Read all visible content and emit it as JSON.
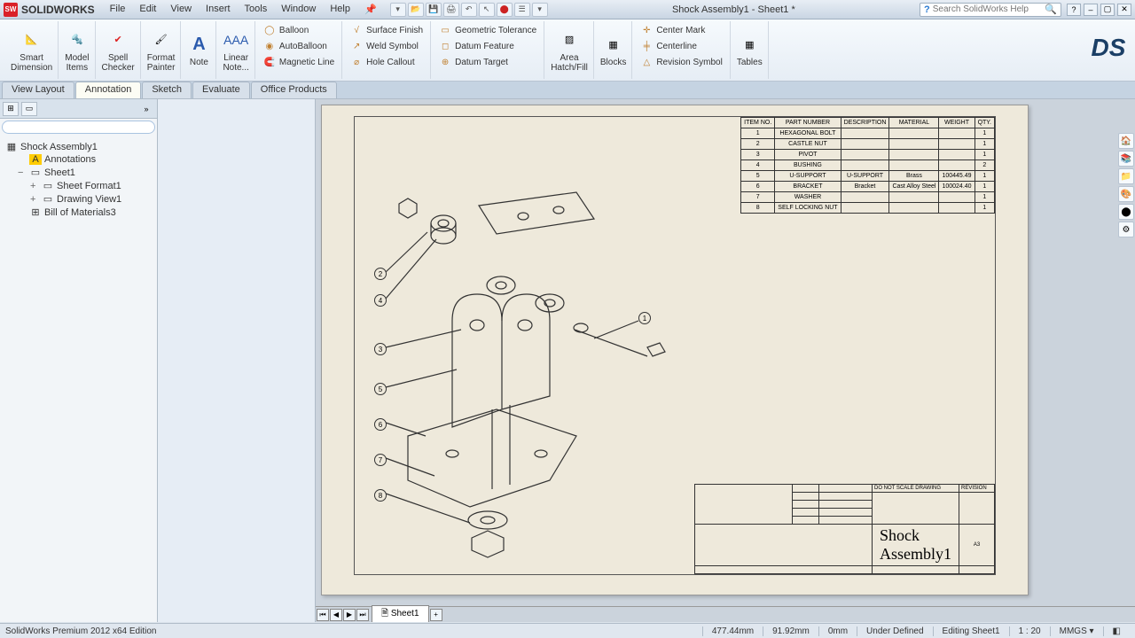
{
  "brand": "SOLIDWORKS",
  "menu": [
    "File",
    "Edit",
    "View",
    "Insert",
    "Tools",
    "Window",
    "Help"
  ],
  "doc_title": "Shock Assembly1 - Sheet1 *",
  "search_placeholder": "Search SolidWorks Help",
  "ribbon": {
    "big": [
      {
        "label": "Smart\nDimension",
        "name": "smart-dimension"
      },
      {
        "label": "Model\nItems",
        "name": "model-items"
      },
      {
        "label": "Spell\nChecker",
        "name": "spell-checker"
      },
      {
        "label": "Format\nPainter",
        "name": "format-painter"
      },
      {
        "label": "Note",
        "name": "note"
      },
      {
        "label": "Linear\nNote...",
        "name": "linear-note"
      }
    ],
    "cols": [
      [
        {
          "l": "Balloon",
          "n": "balloon"
        },
        {
          "l": "AutoBalloon",
          "n": "autoballoon"
        },
        {
          "l": "Magnetic Line",
          "n": "magnetic-line"
        }
      ],
      [
        {
          "l": "Surface Finish",
          "n": "surface-finish"
        },
        {
          "l": "Weld Symbol",
          "n": "weld-symbol"
        },
        {
          "l": "Hole Callout",
          "n": "hole-callout"
        }
      ],
      [
        {
          "l": "Geometric Tolerance",
          "n": "geometric-tolerance"
        },
        {
          "l": "Datum Feature",
          "n": "datum-feature"
        },
        {
          "l": "Datum Target",
          "n": "datum-target"
        }
      ]
    ],
    "big2": [
      {
        "label": "Area\nHatch/Fill",
        "name": "area-hatch"
      },
      {
        "label": "Blocks",
        "name": "blocks"
      }
    ],
    "cols2": [
      [
        {
          "l": "Center Mark",
          "n": "center-mark"
        },
        {
          "l": "Centerline",
          "n": "centerline"
        },
        {
          "l": "Revision Symbol",
          "n": "revision-symbol"
        }
      ]
    ],
    "big3": [
      {
        "label": "Tables",
        "name": "tables"
      }
    ]
  },
  "tabs": [
    "View Layout",
    "Annotation",
    "Sketch",
    "Evaluate",
    "Office Products"
  ],
  "active_tab": 1,
  "tree": {
    "root": "Shock Assembly1",
    "nodes": [
      {
        "l": "Annotations",
        "icon": "A",
        "ind": 1,
        "exp": ""
      },
      {
        "l": "Sheet1",
        "icon": "▭",
        "ind": 1,
        "exp": "−"
      },
      {
        "l": "Sheet Format1",
        "icon": "▭",
        "ind": 2,
        "exp": "+"
      },
      {
        "l": "Drawing View1",
        "icon": "▭",
        "ind": 2,
        "exp": "+"
      },
      {
        "l": "Bill of Materials3",
        "icon": "⊞",
        "ind": 1,
        "exp": ""
      }
    ]
  },
  "bom": {
    "headers": [
      "ITEM NO.",
      "PART NUMBER",
      "DESCRIPTION",
      "MATERIAL",
      "WEIGHT",
      "QTY."
    ],
    "rows": [
      [
        "1",
        "HEXAGONAL BOLT",
        "",
        "",
        "",
        "1"
      ],
      [
        "2",
        "CASTLE NUT",
        "",
        "",
        "",
        "1"
      ],
      [
        "3",
        "PIVOT",
        "",
        "",
        "",
        "1"
      ],
      [
        "4",
        "BUSHING",
        "",
        "",
        "",
        "2"
      ],
      [
        "5",
        "U-SUPPORT",
        "U-SUPPORT",
        "Brass",
        "100445.49",
        "1"
      ],
      [
        "6",
        "BRACKET",
        "Bracket",
        "Cast Alloy Steel",
        "100024.40",
        "1"
      ],
      [
        "7",
        "WASHER",
        "",
        "",
        "",
        "1"
      ],
      [
        "8",
        "SELF LOCKING NUT",
        "",
        "",
        "",
        "1"
      ]
    ]
  },
  "balloons": [
    1,
    2,
    3,
    4,
    5,
    6,
    7,
    8
  ],
  "titleblock_name": "Shock Assembly1",
  "titleblock_size": "A3",
  "sheet_tab": "Sheet1",
  "status": {
    "app": "SolidWorks Premium 2012 x64 Edition",
    "x": "477.44mm",
    "y": "91.92mm",
    "z": "0mm",
    "state": "Under Defined",
    "editing": "Editing Sheet1",
    "scale": "1 : 20",
    "units": "MMGS"
  }
}
